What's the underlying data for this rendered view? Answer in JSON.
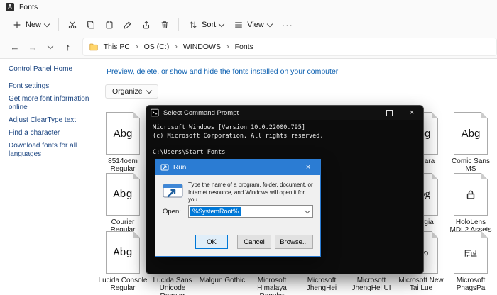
{
  "window": {
    "title": "Fonts"
  },
  "toolbar": {
    "new_label": "New",
    "sort_label": "Sort",
    "view_label": "View"
  },
  "icons": {
    "back": "←",
    "forward": "→",
    "up": "↑",
    "more": "···",
    "close": "×",
    "crumb_sep": "›"
  },
  "breadcrumbs": [
    "This PC",
    "OS (C:)",
    "WINDOWS",
    "Fonts"
  ],
  "sidebar": {
    "home": "Control Panel Home",
    "items": [
      "Font settings",
      "Get more font information online",
      "Adjust ClearType text",
      "Find a character",
      "Download fonts for all languages"
    ]
  },
  "main": {
    "heading": "Preview, delete, or show and hide the fonts installed on your computer",
    "organize_label": "Organize"
  },
  "tiles": [
    {
      "label": "8514oem Regular",
      "glyph": "Abg"
    },
    {
      "label": "Candara",
      "glyph": "Abg"
    },
    {
      "label": "Comic Sans MS",
      "glyph": "Abg"
    },
    {
      "label": "Courier Regular",
      "glyph": "Abg"
    },
    {
      "label": "Georgia",
      "glyph": "Abg"
    },
    {
      "label": "HoloLens MDL2 Assets Regular",
      "glyph": ""
    },
    {
      "label": "Lucida Console Regular",
      "glyph": "Abg"
    },
    {
      "label": "Lucida Sans Unicode Regular",
      "glyph": ""
    },
    {
      "label": "Malgun Gothic",
      "glyph": ""
    },
    {
      "label": "Microsoft Himalaya Regular",
      "glyph": ""
    },
    {
      "label": "Microsoft JhengHei",
      "glyph": ""
    },
    {
      "label": "Microsoft JhengHei UI",
      "glyph": ""
    },
    {
      "label": "Microsoft New Tai Lue",
      "glyph": "ᦂᦟ"
    },
    {
      "label": "Microsoft PhagsPa",
      "glyph": "ꡀꡙ"
    }
  ],
  "cmd": {
    "title": "Select Command Prompt",
    "lines": [
      "Microsoft Windows [Version 10.0.22000.795]",
      "(c) Microsoft Corporation. All rights reserved.",
      "",
      "C:\\Users\\Start Fonts"
    ]
  },
  "run": {
    "title": "Run",
    "description": "Type the name of a program, folder, document, or Internet resource, and Windows will open it for you.",
    "open_label": "Open:",
    "open_value": "%SystemRoot%",
    "ok": "OK",
    "cancel": "Cancel",
    "browse": "Browse..."
  },
  "colors": {
    "accent": "#0078d7",
    "run_titlebar": "#2b7cd3",
    "heading_blue": "#0b5fb0"
  }
}
